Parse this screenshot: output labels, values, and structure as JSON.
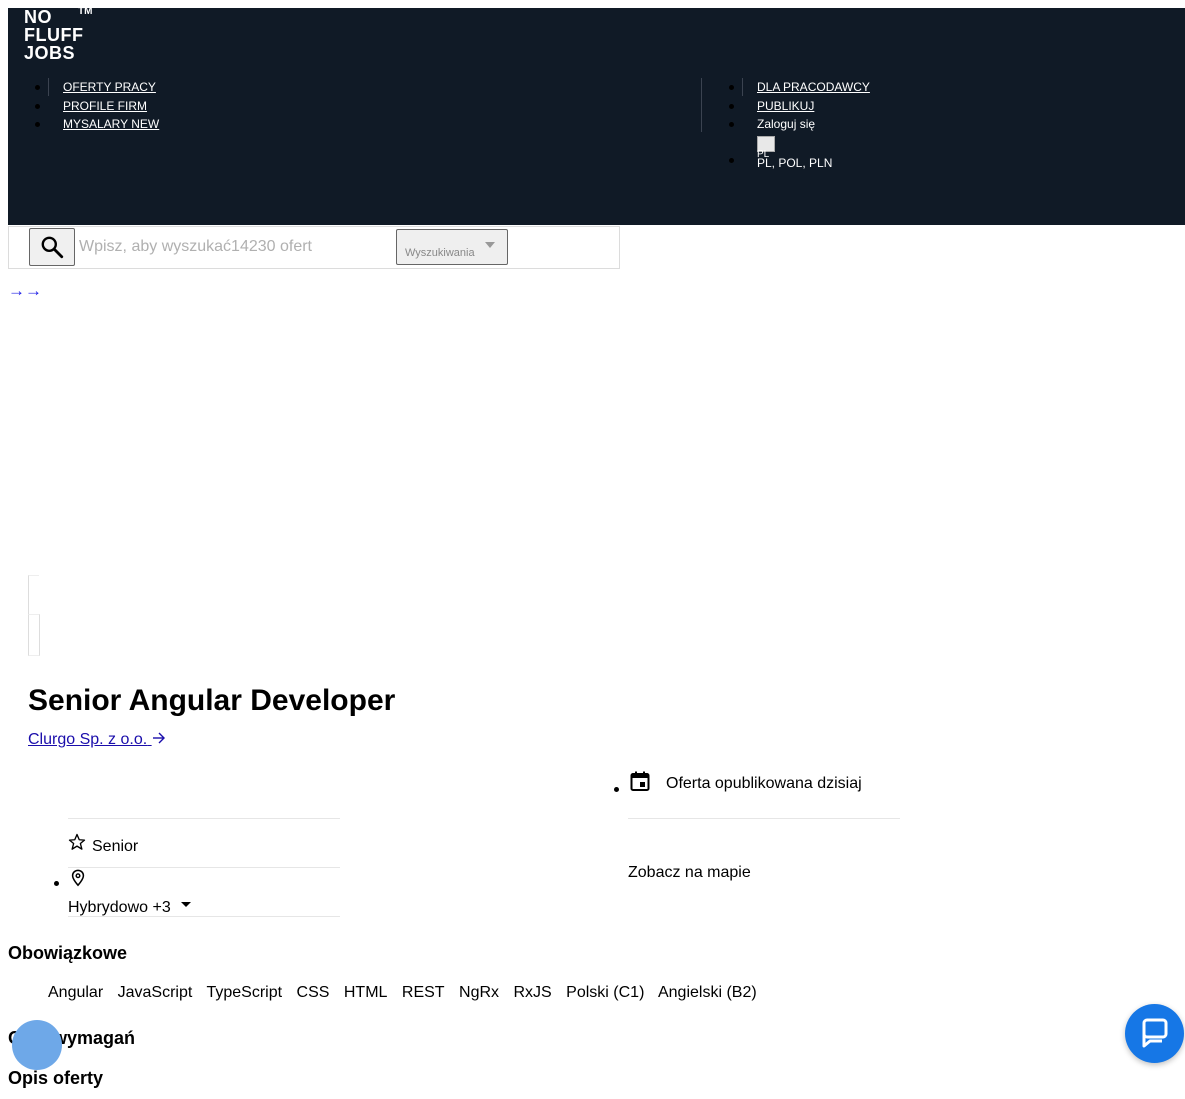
{
  "header": {
    "logo_lines": [
      "NO",
      "FLUFF",
      "JOBS"
    ],
    "logo_tm": "TM",
    "nav_left": [
      "OFERTY PRACY",
      "PROFILE FIRM",
      "MYSALARY NEW"
    ],
    "nav_right": {
      "employers": "DLA PRACODAWCY",
      "publish": "PUBLIKUJ",
      "login": "Zaloguj się",
      "flag_alt": "PL",
      "locale": "PL, POL, PLN"
    },
    "background": "#101a26"
  },
  "search": {
    "placeholder": "Wpisz, aby wyszukać14230 ofert",
    "select_label": "Wyszukiwania",
    "icon": "search-icon"
  },
  "arrows": "→→",
  "job": {
    "title": "Senior Angular Developer",
    "company": "Clurgo Sp. z o.o.",
    "published": "Oferta opublikowana dzisiaj",
    "seniority": "Senior",
    "location": "Hybrydowo +3",
    "map_link": "Zobacz na mapie"
  },
  "sections": {
    "required": "Obowiązkowe",
    "requirements_desc": "Opis wymagań",
    "offer_desc": "Opis oferty"
  },
  "skills": [
    "Angular",
    "JavaScript",
    "TypeScript",
    "CSS",
    "HTML",
    "REST",
    "NgRx",
    "RxJS",
    "Polski (C1)",
    "Angielski (B2)"
  ],
  "accent_colors": {
    "chat": "#1677e6",
    "feedback": "#6ea8e8",
    "link": "#1a0dab"
  }
}
